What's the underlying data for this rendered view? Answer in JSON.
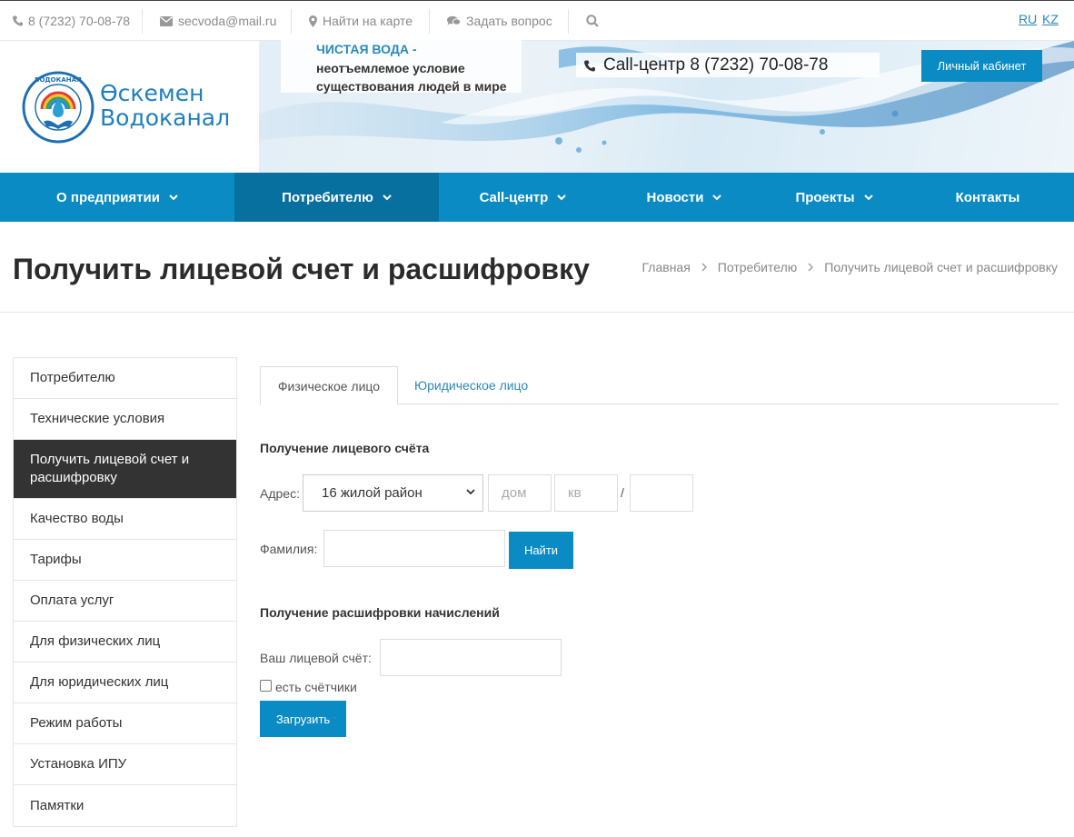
{
  "topbar": {
    "phone": "8 (7232) 70-08-78",
    "email": "secvoda@mail.ru",
    "map": "Найти на карте",
    "ask": "Задать вопрос",
    "lang_ru": "RU",
    "lang_kz": "KZ"
  },
  "header": {
    "logo_line1": "Өскемен",
    "logo_line2": "Водоканал",
    "logo_ring_text": "ӨСКЕМЕН ВОДОКАНАЛ",
    "slogan_title": "ЧИСТАЯ ВОДА -",
    "slogan_line1": "неотъемлемое условие",
    "slogan_line2": "существования людей в мире",
    "call_center": "Call-центр 8 (7232) 70-08-78",
    "cabinet_button": "Личный кабинет"
  },
  "nav": {
    "items": [
      {
        "label": "О предприятии"
      },
      {
        "label": "Потребителю"
      },
      {
        "label": "Call-центр"
      },
      {
        "label": "Новости"
      },
      {
        "label": "Проекты"
      },
      {
        "label": "Контакты"
      }
    ]
  },
  "page": {
    "title": "Получить лицевой счет и расшифровку",
    "breadcrumb": [
      "Главная",
      "Потребителю",
      "Получить лицевой счет и расшифровку"
    ]
  },
  "sidebar": {
    "items": [
      {
        "label": "Потребителю"
      },
      {
        "label": "Технические условия"
      },
      {
        "label": "Получить лицевой счет и расшифровку"
      },
      {
        "label": "Качество воды"
      },
      {
        "label": "Тарифы"
      },
      {
        "label": "Оплата услуг"
      },
      {
        "label": "Для физических лиц"
      },
      {
        "label": "Для юридических лиц"
      },
      {
        "label": "Режим работы"
      },
      {
        "label": "Установка ИПУ"
      },
      {
        "label": "Памятки"
      }
    ]
  },
  "tabs": {
    "individual": "Физическое лицо",
    "legal": "Юридическое лицо"
  },
  "account_form": {
    "title": "Получение лицевого счёта",
    "address_label": "Адрес:",
    "district_value": "16 жилой район",
    "house_placeholder": "дом",
    "apt_placeholder": "кв",
    "slash": "/",
    "surname_label": "Фамилия:",
    "find_button": "Найти"
  },
  "decode_form": {
    "title": "Получение расшифровки начислений",
    "account_label": "Ваш лицевой счёт:",
    "meters_label": "есть счётчики",
    "load_button": "Загрузить"
  },
  "colors": {
    "brand_blue": "#0a8bc3",
    "nav_active": "#08709f",
    "sidebar_active": "#333333",
    "link_blue": "#2a8ab9"
  }
}
